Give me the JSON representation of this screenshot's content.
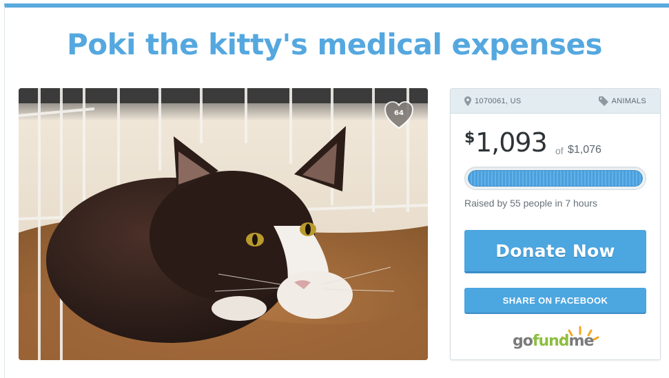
{
  "campaign": {
    "title": "Poki the kitty's medical expenses",
    "hearts_count": "64"
  },
  "card": {
    "location": "1070061, US",
    "category": "ANIMALS",
    "currency_symbol": "$",
    "raised_amount": "1,093",
    "goal_prefix": "of",
    "goal_amount": "$1,076",
    "progress_fraction": 1.0,
    "raised_line": "Raised by 55 people in 7 hours",
    "donate_label": "Donate Now",
    "share_label": "SHARE ON FACEBOOK"
  },
  "brand": {
    "go": "go",
    "fund": "fund",
    "me": "me"
  },
  "colors": {
    "accent": "#55a8df",
    "button": "#4ca6e0",
    "brand_green": "#8cbf3f",
    "brand_orange": "#f5a623"
  },
  "icons": {
    "location": "map-pin-icon",
    "category": "tag-icon",
    "favorite": "heart-icon"
  }
}
